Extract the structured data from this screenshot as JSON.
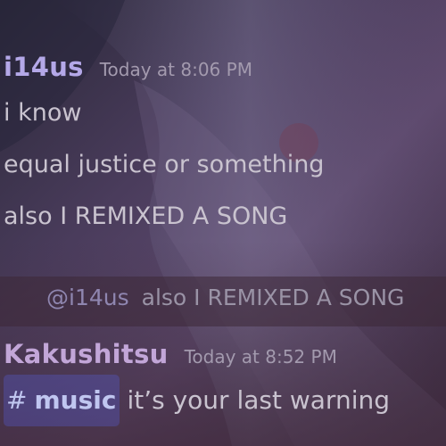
{
  "colors": {
    "username_i14us": "#b4a8e8",
    "username_kakushitsu": "#c2a6d8",
    "timestamp": "#a39aae",
    "message_text": "#c9c3cf",
    "channel_mention_bg": "#5865f2"
  },
  "messages": [
    {
      "author": "i14us",
      "timestamp": "Today at 8:06 PM",
      "lines": [
        "i know",
        "equal justice or something",
        "also I REMIXED A SONG"
      ]
    },
    {
      "author": "Kakushitsu",
      "timestamp": "Today at 8:52 PM",
      "reply": {
        "mention": "@i14us",
        "content": "also I REMIXED A SONG"
      },
      "channel_mention": {
        "icon": "#",
        "name": "music"
      },
      "text": "it’s your last warning"
    }
  ]
}
